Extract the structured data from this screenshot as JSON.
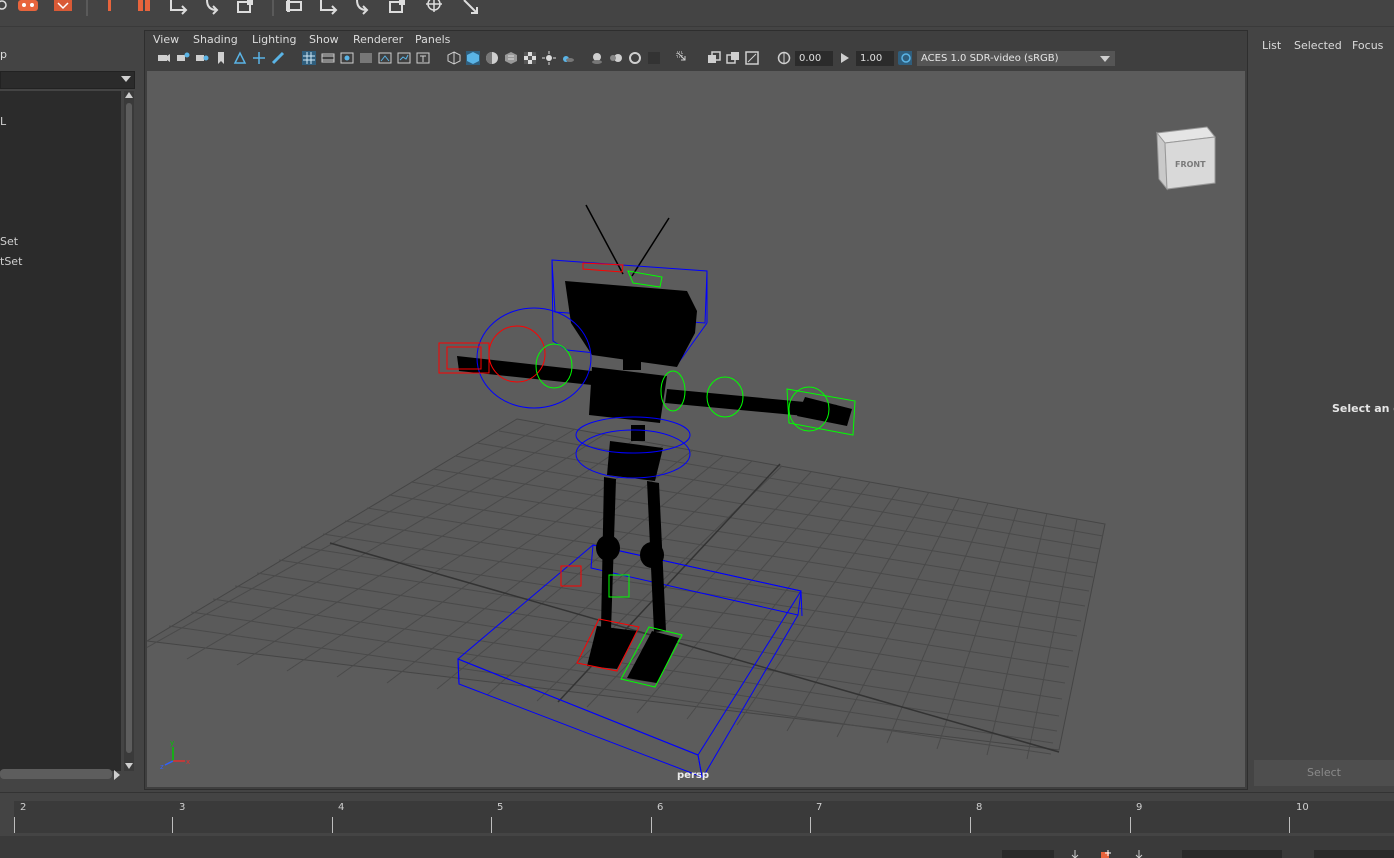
{
  "outliner": {
    "header": "p",
    "items": [
      "L",
      "Set",
      "tSet"
    ]
  },
  "viewport": {
    "menu": [
      "View",
      "Shading",
      "Lighting",
      "Show",
      "Renderer",
      "Panels"
    ],
    "exposure_value": "0.00",
    "gamma_value": "1.00",
    "color_space": "ACES 1.0 SDR-video (sRGB)",
    "camera_label": "persp",
    "view_cube_label": "FRONT"
  },
  "right_panel": {
    "tabs": [
      "List",
      "Selected",
      "Focus"
    ],
    "message": "Select an ob",
    "select_button": "Select"
  },
  "timeline": {
    "ticks": [
      "2",
      "3",
      "4",
      "5",
      "6",
      "7",
      "8",
      "9",
      "10"
    ]
  },
  "colors": {
    "selection_red": "#ff0000",
    "controller_green": "#00ff00",
    "controller_blue": "#0000ff",
    "accent_orange": "#e8643c",
    "toolbar_blue": "#5ab4e6"
  }
}
